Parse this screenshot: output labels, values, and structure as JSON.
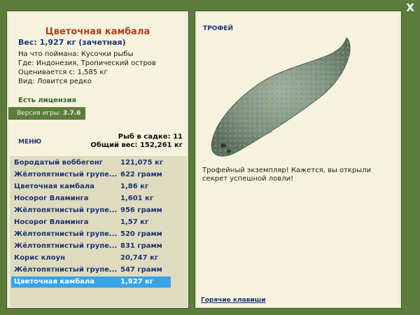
{
  "window": {
    "close_label": "X"
  },
  "fish_card": {
    "title": "Цветочная камбала",
    "weight": "Вес: 1,927 кг (зачетная)",
    "bait": "На что поймана: Кусочки рыбы",
    "location": "Где: Индонезия, Тропический остров",
    "value": "Оценивается с: 1,585 кг",
    "kind": "Вид: Ловится редко",
    "license": "Есть лицензия",
    "version_label": "Версия игры:",
    "version_value": "3.7.6"
  },
  "menu_label": "МЕНЮ",
  "stats": {
    "fish_count": "Рыб в садке: 11",
    "total_weight": "Общий вес: 152,261 кг"
  },
  "catch_list": [
    {
      "name": "Бородатый воббегонг",
      "weight": "121,075 кг"
    },
    {
      "name": "Жёлтопятнистый групе...",
      "weight": "622 грамм"
    },
    {
      "name": "Цветочная камбала",
      "weight": "1,86 кг"
    },
    {
      "name": "Носорог Вламинга",
      "weight": "1,601 кг"
    },
    {
      "name": "Жёлтопятнистый групе...",
      "weight": "956 грамм"
    },
    {
      "name": "Носорог Вламинга",
      "weight": "1,57 кг"
    },
    {
      "name": "Жёлтопятнистый групе...",
      "weight": "520 грамм"
    },
    {
      "name": "Жёлтопятнистый групе...",
      "weight": "831 грамм"
    },
    {
      "name": "Корис клоун",
      "weight": "20,747 кг"
    },
    {
      "name": "Жёлтопятнистый групе...",
      "weight": "547 грамм"
    },
    {
      "name": "Цветочная камбала",
      "weight": "1,927 кг"
    }
  ],
  "selected_index": 10,
  "trophy": {
    "heading": "ТРОФЕЙ",
    "text": "Трофейный экземпляр! Кажется, вы открыли секрет успешной ловли!",
    "hotkeys": "Горячие клавиши"
  },
  "colors": {
    "background": "#5c7c3c",
    "panel": "#f5f2de",
    "title_accent": "#b33d16",
    "link_text": "#1e3374",
    "selection": "#3aa3e6"
  }
}
